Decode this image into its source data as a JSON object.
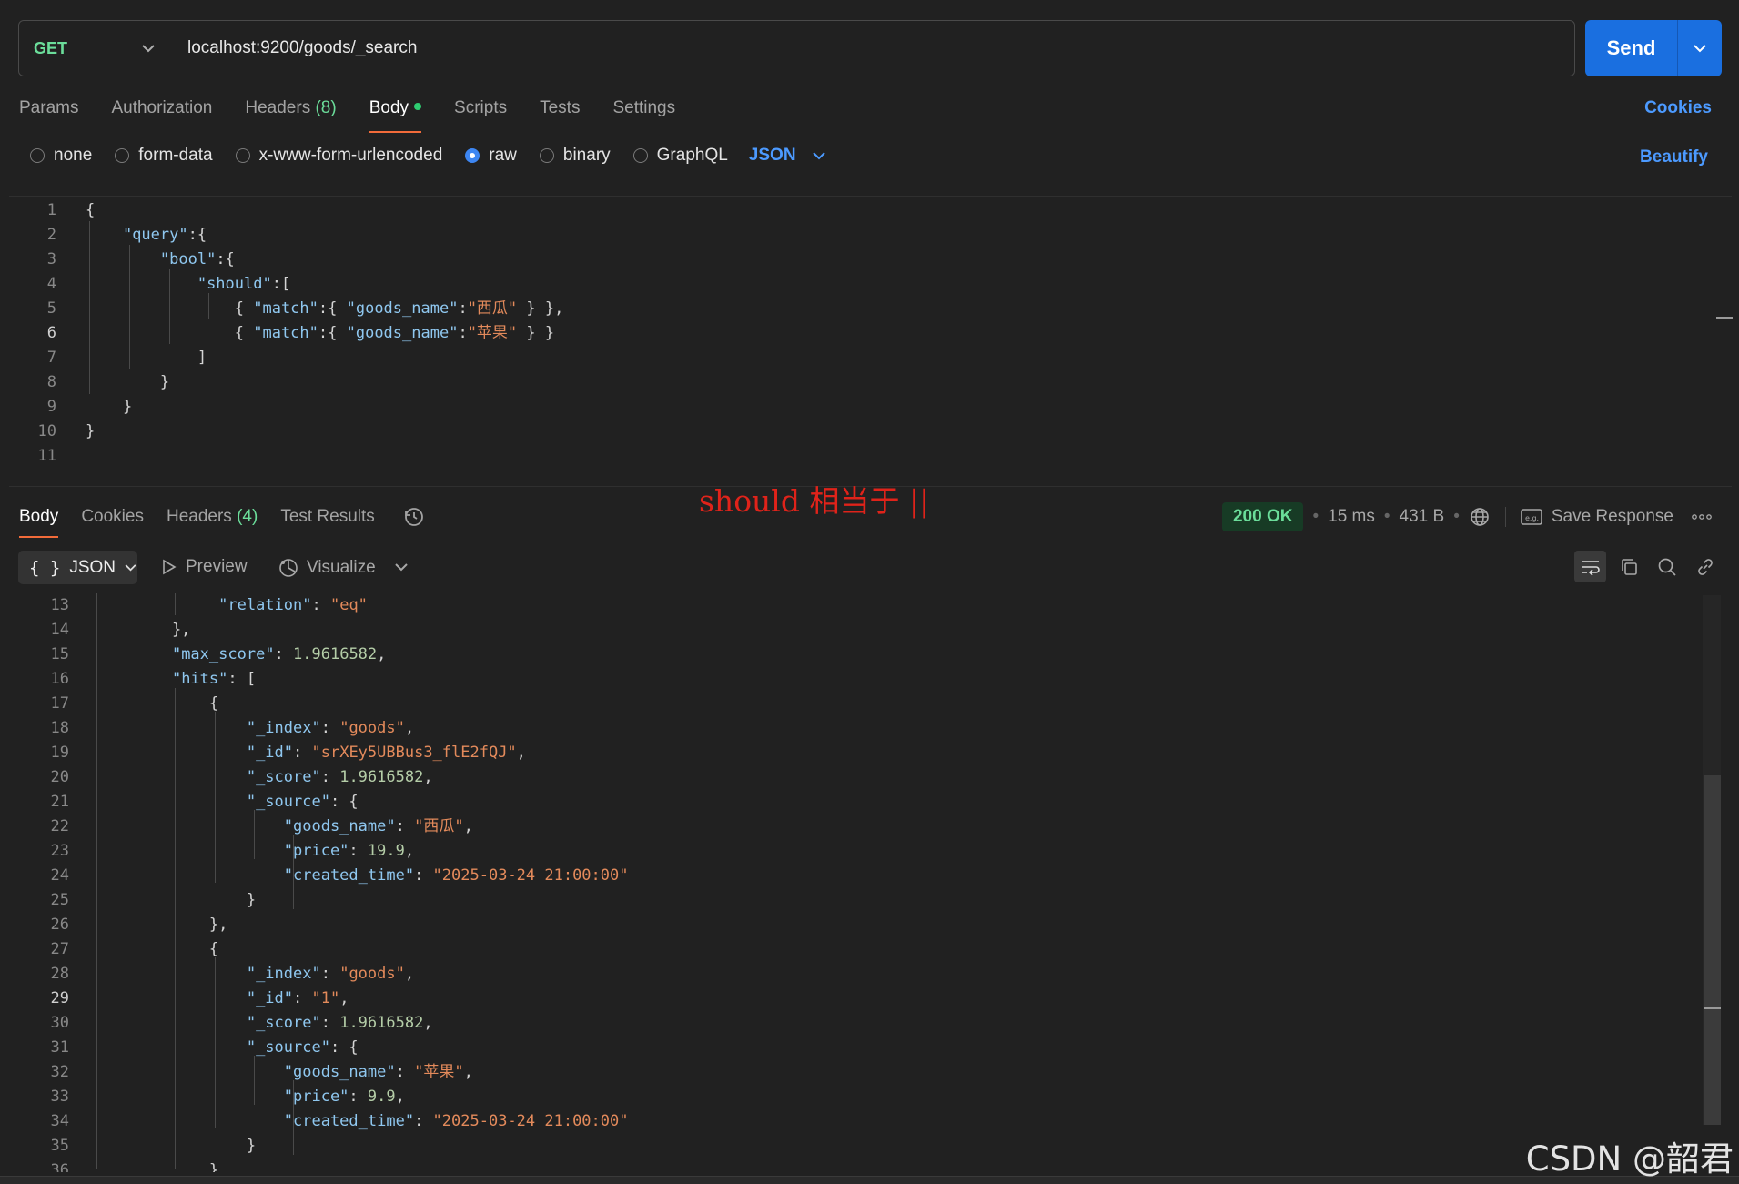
{
  "request": {
    "method": "GET",
    "url": "localhost:9200/goods/_search",
    "send_label": "Send"
  },
  "req_tabs": {
    "params": "Params",
    "authorization": "Authorization",
    "headers": "Headers",
    "headers_count": "(8)",
    "body": "Body",
    "scripts": "Scripts",
    "tests": "Tests",
    "settings": "Settings",
    "cookies": "Cookies"
  },
  "body_types": {
    "none": "none",
    "form_data": "form-data",
    "urlencoded": "x-www-form-urlencoded",
    "raw": "raw",
    "binary": "binary",
    "graphql": "GraphQL",
    "format": "JSON",
    "beautify": "Beautify"
  },
  "request_body": {
    "line_numbers": [
      "1",
      "2",
      "3",
      "4",
      "5",
      "6",
      "7",
      "8",
      "9",
      "10",
      "11"
    ],
    "keys": [
      "\"query\"",
      "\"bool\"",
      "\"should\"",
      "\"match\"",
      "\"goods_name\""
    ],
    "values": [
      "\"西瓜\"",
      "\"苹果\""
    ]
  },
  "annotation": "should 相当于 ||",
  "response": {
    "tabs": {
      "body": "Body",
      "cookies": "Cookies",
      "headers": "Headers",
      "headers_count": "(4)",
      "test_results": "Test Results"
    },
    "status": "200 OK",
    "time": "15 ms",
    "size": "431 B",
    "save_response": "Save Response",
    "format": "JSON",
    "preview": "Preview",
    "visualize": "Visualize",
    "line_numbers": [
      "13",
      "14",
      "15",
      "16",
      "17",
      "18",
      "19",
      "20",
      "21",
      "22",
      "23",
      "24",
      "25",
      "26",
      "27",
      "28",
      "29",
      "30",
      "31",
      "32",
      "33",
      "34",
      "35",
      "36"
    ],
    "keys": {
      "relation": "\"relation\"",
      "max_score": "\"max_score\"",
      "hits": "\"hits\"",
      "index": "\"_index\"",
      "id": "\"_id\"",
      "score": "\"_score\"",
      "source": "\"_source\"",
      "goods_name": "\"goods_name\"",
      "price": "\"price\"",
      "created_time": "\"created_time\""
    },
    "values": {
      "relation": "\"eq\"",
      "max_score": "1.9616582",
      "index_1": "\"goods\"",
      "id_1": "\"srXEy5UBBus3_flE2fQJ\"",
      "score_1": "1.9616582",
      "goods_name_1": "\"西瓜\"",
      "price_1": "19.9",
      "created_time_1": "\"2025-03-24 21:00:00\"",
      "index_2": "\"goods\"",
      "id_2": "\"1\"",
      "score_2": "1.9616582",
      "goods_name_2": "\"苹果\"",
      "price_2": "9.9",
      "created_time_2": "\"2025-03-24 21:00:00\""
    }
  },
  "watermark": "CSDN @韶君"
}
